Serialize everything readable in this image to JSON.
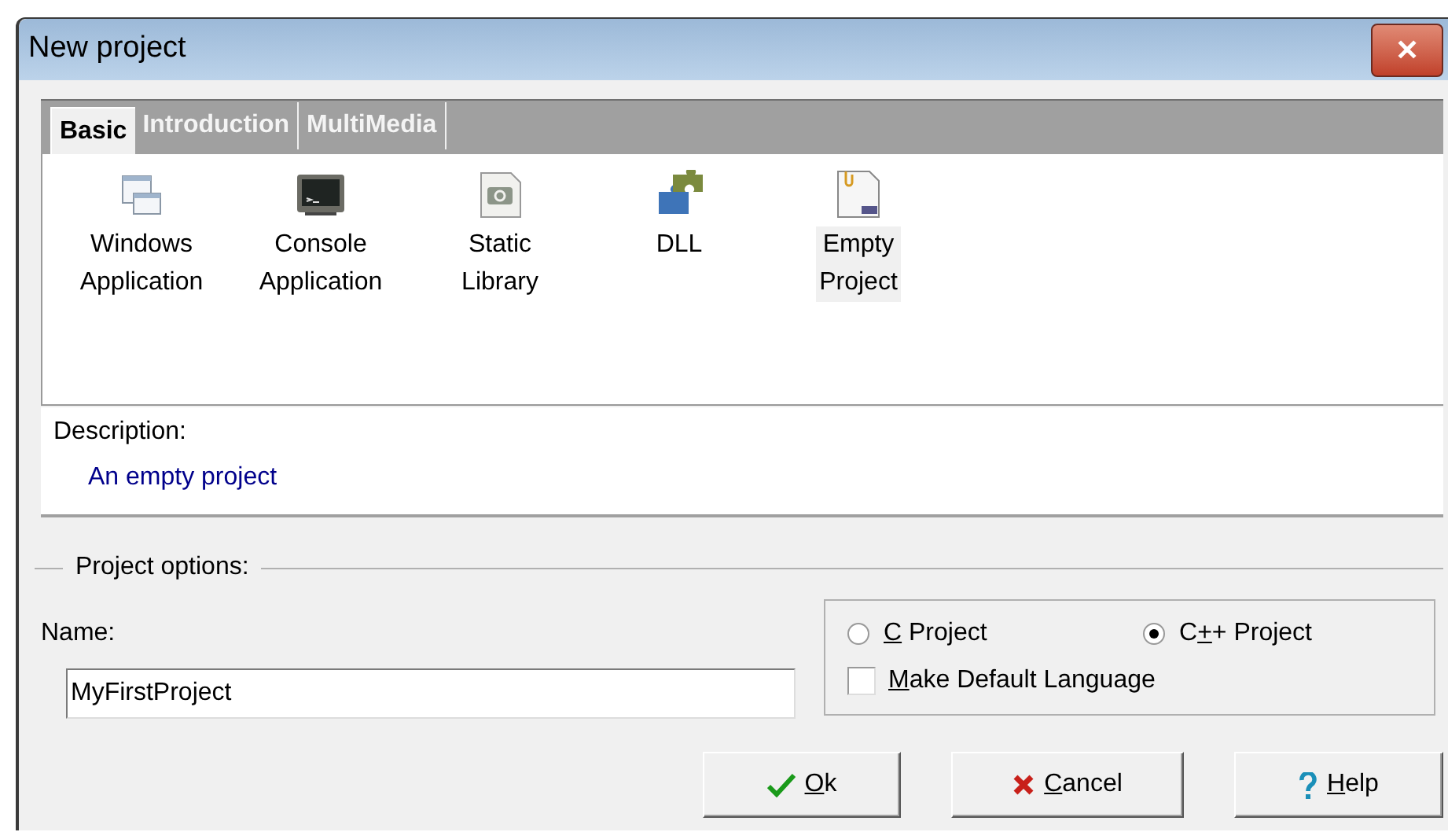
{
  "window": {
    "title": "New project",
    "close": "✕"
  },
  "tabs": [
    {
      "label": "Basic",
      "selected": true
    },
    {
      "label": "Introduction",
      "selected": false
    },
    {
      "label": "MultiMedia",
      "selected": false
    }
  ],
  "templates": [
    {
      "label": "Windows Application",
      "kind": "windows",
      "selected": false
    },
    {
      "label": "Console Application",
      "kind": "console",
      "selected": false
    },
    {
      "label": "Static Library",
      "kind": "library",
      "selected": false
    },
    {
      "label": "DLL",
      "kind": "dll",
      "selected": false
    },
    {
      "label": "Empty Project",
      "kind": "empty",
      "selected": true
    }
  ],
  "description": {
    "label": "Description:",
    "text": "An empty project"
  },
  "project_options": {
    "legend": "Project options:",
    "name_label": "Name:",
    "name_value": "MyFirstProject",
    "language": [
      {
        "key": "C",
        "post": " Project",
        "selected": false
      },
      {
        "pre": "C",
        "key": "+",
        "post": "+ Project",
        "selected": true
      }
    ],
    "default_language": {
      "key": "M",
      "post": "ake Default Language",
      "checked": false
    }
  },
  "buttons": [
    {
      "kind": "ok",
      "key": "O",
      "post": "k"
    },
    {
      "kind": "cancel",
      "key": "C",
      "post": "ancel"
    },
    {
      "kind": "help",
      "key": "H",
      "post": "elp"
    }
  ]
}
